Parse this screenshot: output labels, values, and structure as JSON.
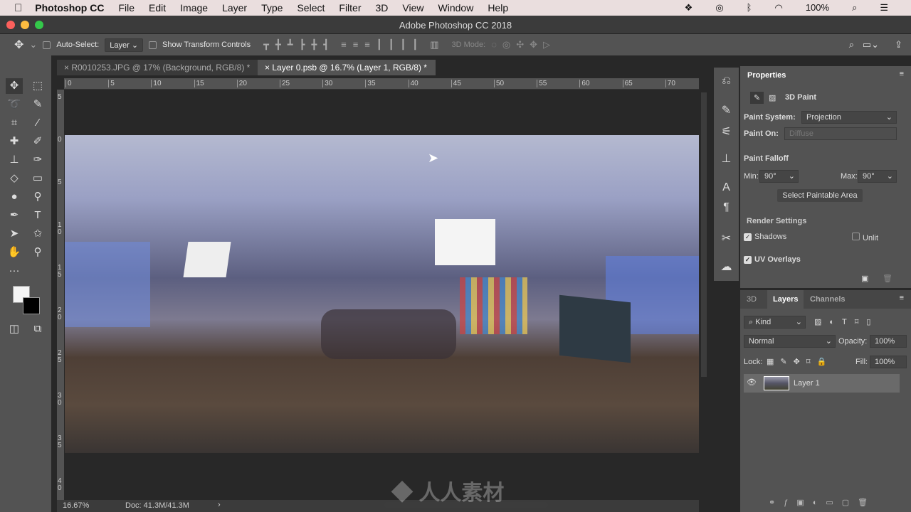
{
  "menubar": {
    "app": "Photoshop CC",
    "items": [
      "File",
      "Edit",
      "Image",
      "Layer",
      "Type",
      "Select",
      "Filter",
      "3D",
      "View",
      "Window",
      "Help"
    ],
    "battery": "100%"
  },
  "window": {
    "title": "Adobe Photoshop CC 2018"
  },
  "options": {
    "auto_select_label": "Auto-Select:",
    "auto_select_value": "Layer",
    "show_transform_label": "Show Transform Controls",
    "mode_3d_label": "3D Mode:"
  },
  "tabs": [
    {
      "label": "R0010253.JPG @ 17% (Background, RGB/8) *",
      "active": false
    },
    {
      "label": "Layer 0.psb @ 16.7% (Layer 1, RGB/8) *",
      "active": true
    }
  ],
  "ruler": {
    "h": [
      "0",
      "5",
      "10",
      "15",
      "20",
      "25",
      "30",
      "35",
      "40",
      "45",
      "50",
      "55",
      "60",
      "65",
      "70"
    ],
    "v": [
      "5",
      "0",
      "5",
      "1 0",
      "1 5",
      "2 0",
      "2 5",
      "3 0",
      "3 5",
      "4 0"
    ]
  },
  "status": {
    "zoom": "16.67%",
    "doc": "Doc: 41.3M/41.3M"
  },
  "properties": {
    "title": "Properties",
    "mode": "3D Paint",
    "paint_system_label": "Paint System:",
    "paint_system_value": "Projection",
    "paint_on_label": "Paint On:",
    "paint_on_value": "Diffuse",
    "falloff_title": "Paint Falloff",
    "min_label": "Min:",
    "min_value": "90°",
    "max_label": "Max:",
    "max_value": "90°",
    "select_area": "Select Paintable Area",
    "render_title": "Render Settings",
    "shadows": "Shadows",
    "shadows_checked": true,
    "unlit": "Unlit",
    "unlit_checked": false,
    "uv_overlays": "UV Overlays",
    "uv_checked": true
  },
  "layers_panel": {
    "tabs": [
      "3D",
      "Layers",
      "Channels"
    ],
    "active_tab": "Layers",
    "filter": "Kind",
    "blend": "Normal",
    "opacity_label": "Opacity:",
    "opacity": "100%",
    "lock_label": "Lock:",
    "fill_label": "Fill:",
    "fill": "100%",
    "layers": [
      {
        "name": "Layer 1",
        "visible": true
      }
    ]
  },
  "watermark": "人人素材"
}
